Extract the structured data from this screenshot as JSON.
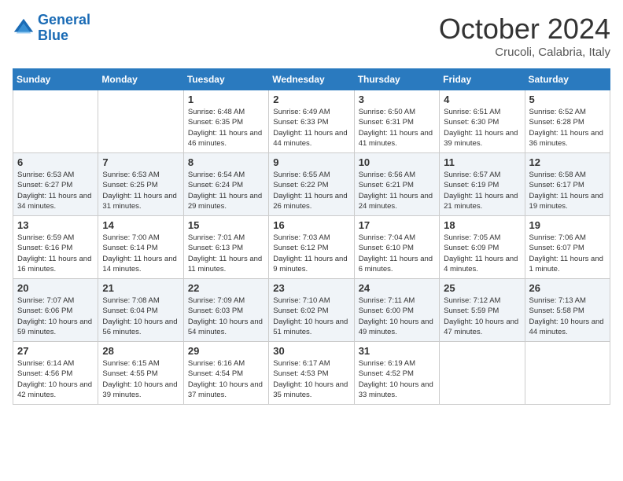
{
  "header": {
    "logo_line1": "General",
    "logo_line2": "Blue",
    "month": "October 2024",
    "location": "Crucoli, Calabria, Italy"
  },
  "weekdays": [
    "Sunday",
    "Monday",
    "Tuesday",
    "Wednesday",
    "Thursday",
    "Friday",
    "Saturday"
  ],
  "weeks": [
    [
      {
        "day": "",
        "info": ""
      },
      {
        "day": "",
        "info": ""
      },
      {
        "day": "1",
        "info": "Sunrise: 6:48 AM\nSunset: 6:35 PM\nDaylight: 11 hours and 46 minutes."
      },
      {
        "day": "2",
        "info": "Sunrise: 6:49 AM\nSunset: 6:33 PM\nDaylight: 11 hours and 44 minutes."
      },
      {
        "day": "3",
        "info": "Sunrise: 6:50 AM\nSunset: 6:31 PM\nDaylight: 11 hours and 41 minutes."
      },
      {
        "day": "4",
        "info": "Sunrise: 6:51 AM\nSunset: 6:30 PM\nDaylight: 11 hours and 39 minutes."
      },
      {
        "day": "5",
        "info": "Sunrise: 6:52 AM\nSunset: 6:28 PM\nDaylight: 11 hours and 36 minutes."
      }
    ],
    [
      {
        "day": "6",
        "info": "Sunrise: 6:53 AM\nSunset: 6:27 PM\nDaylight: 11 hours and 34 minutes."
      },
      {
        "day": "7",
        "info": "Sunrise: 6:53 AM\nSunset: 6:25 PM\nDaylight: 11 hours and 31 minutes."
      },
      {
        "day": "8",
        "info": "Sunrise: 6:54 AM\nSunset: 6:24 PM\nDaylight: 11 hours and 29 minutes."
      },
      {
        "day": "9",
        "info": "Sunrise: 6:55 AM\nSunset: 6:22 PM\nDaylight: 11 hours and 26 minutes."
      },
      {
        "day": "10",
        "info": "Sunrise: 6:56 AM\nSunset: 6:21 PM\nDaylight: 11 hours and 24 minutes."
      },
      {
        "day": "11",
        "info": "Sunrise: 6:57 AM\nSunset: 6:19 PM\nDaylight: 11 hours and 21 minutes."
      },
      {
        "day": "12",
        "info": "Sunrise: 6:58 AM\nSunset: 6:17 PM\nDaylight: 11 hours and 19 minutes."
      }
    ],
    [
      {
        "day": "13",
        "info": "Sunrise: 6:59 AM\nSunset: 6:16 PM\nDaylight: 11 hours and 16 minutes."
      },
      {
        "day": "14",
        "info": "Sunrise: 7:00 AM\nSunset: 6:14 PM\nDaylight: 11 hours and 14 minutes."
      },
      {
        "day": "15",
        "info": "Sunrise: 7:01 AM\nSunset: 6:13 PM\nDaylight: 11 hours and 11 minutes."
      },
      {
        "day": "16",
        "info": "Sunrise: 7:03 AM\nSunset: 6:12 PM\nDaylight: 11 hours and 9 minutes."
      },
      {
        "day": "17",
        "info": "Sunrise: 7:04 AM\nSunset: 6:10 PM\nDaylight: 11 hours and 6 minutes."
      },
      {
        "day": "18",
        "info": "Sunrise: 7:05 AM\nSunset: 6:09 PM\nDaylight: 11 hours and 4 minutes."
      },
      {
        "day": "19",
        "info": "Sunrise: 7:06 AM\nSunset: 6:07 PM\nDaylight: 11 hours and 1 minute."
      }
    ],
    [
      {
        "day": "20",
        "info": "Sunrise: 7:07 AM\nSunset: 6:06 PM\nDaylight: 10 hours and 59 minutes."
      },
      {
        "day": "21",
        "info": "Sunrise: 7:08 AM\nSunset: 6:04 PM\nDaylight: 10 hours and 56 minutes."
      },
      {
        "day": "22",
        "info": "Sunrise: 7:09 AM\nSunset: 6:03 PM\nDaylight: 10 hours and 54 minutes."
      },
      {
        "day": "23",
        "info": "Sunrise: 7:10 AM\nSunset: 6:02 PM\nDaylight: 10 hours and 51 minutes."
      },
      {
        "day": "24",
        "info": "Sunrise: 7:11 AM\nSunset: 6:00 PM\nDaylight: 10 hours and 49 minutes."
      },
      {
        "day": "25",
        "info": "Sunrise: 7:12 AM\nSunset: 5:59 PM\nDaylight: 10 hours and 47 minutes."
      },
      {
        "day": "26",
        "info": "Sunrise: 7:13 AM\nSunset: 5:58 PM\nDaylight: 10 hours and 44 minutes."
      }
    ],
    [
      {
        "day": "27",
        "info": "Sunrise: 6:14 AM\nSunset: 4:56 PM\nDaylight: 10 hours and 42 minutes."
      },
      {
        "day": "28",
        "info": "Sunrise: 6:15 AM\nSunset: 4:55 PM\nDaylight: 10 hours and 39 minutes."
      },
      {
        "day": "29",
        "info": "Sunrise: 6:16 AM\nSunset: 4:54 PM\nDaylight: 10 hours and 37 minutes."
      },
      {
        "day": "30",
        "info": "Sunrise: 6:17 AM\nSunset: 4:53 PM\nDaylight: 10 hours and 35 minutes."
      },
      {
        "day": "31",
        "info": "Sunrise: 6:19 AM\nSunset: 4:52 PM\nDaylight: 10 hours and 33 minutes."
      },
      {
        "day": "",
        "info": ""
      },
      {
        "day": "",
        "info": ""
      }
    ]
  ]
}
